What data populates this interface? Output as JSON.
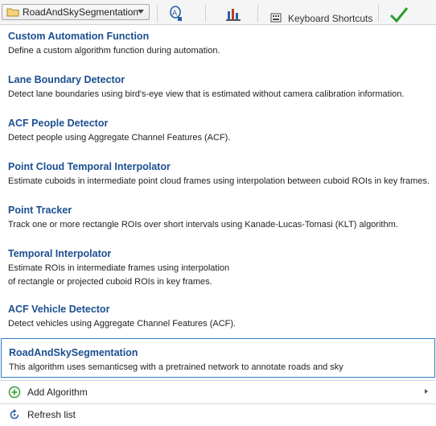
{
  "toolbar": {
    "selected_algorithm": "RoadAndSkySegmentation",
    "partial_label": "Keyboard Shortcuts",
    "icons": [
      "folder-icon",
      "text-search-icon",
      "import-icon",
      "keyboard-icon",
      "checkmark-icon"
    ]
  },
  "menu": {
    "items": [
      {
        "title": "Custom Automation Function",
        "desc": [
          "Define a custom algorithm function during automation."
        ]
      },
      {
        "title": "Lane Boundary Detector",
        "desc": [
          "Detect lane boundaries using bird's-eye view that is estimated without camera calibration information."
        ]
      },
      {
        "title": "ACF People Detector",
        "desc": [
          "Detect people using Aggregate Channel Features (ACF)."
        ]
      },
      {
        "title": "Point Cloud Temporal Interpolator",
        "desc": [
          "Estimate cuboids in intermediate point cloud frames using interpolation between cuboid ROIs in key frames."
        ]
      },
      {
        "title": "Point Tracker",
        "desc": [
          "Track one or more rectangle ROIs over short intervals using Kanade-Lucas-Tomasi (KLT) algorithm."
        ]
      },
      {
        "title": "Temporal Interpolator",
        "desc": [
          "Estimate ROIs in intermediate frames using interpolation",
          "of rectangle or projected cuboid ROIs in key frames."
        ]
      },
      {
        "title": "ACF Vehicle Detector",
        "desc": [
          "Detect vehicles using Aggregate Channel Features (ACF)."
        ]
      },
      {
        "title": "RoadAndSkySegmentation",
        "desc": [
          "This algorithm uses semanticseg with a pretrained network to annotate roads and sky"
        ]
      }
    ],
    "actions": {
      "add_algorithm": "Add Algorithm",
      "refresh_list": "Refresh list"
    }
  },
  "colors": {
    "title_blue": "#1b4f8f",
    "selection_border": "#2b7bc4",
    "add_icon_green": "#2e9b2e"
  }
}
